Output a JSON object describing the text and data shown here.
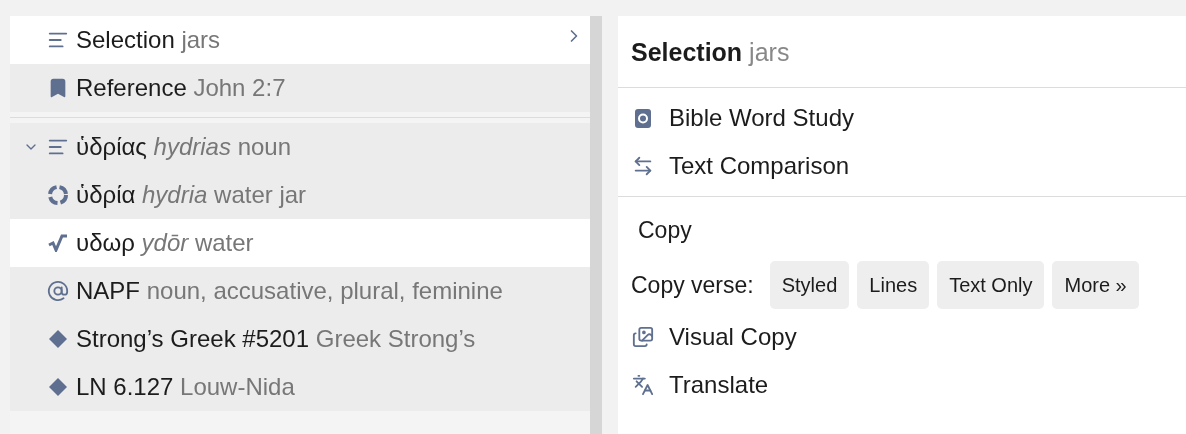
{
  "lookup_panel": {
    "sections": [
      {
        "rows": [
          {
            "kind": "selection",
            "label": "Selection",
            "detail": "jars",
            "highlighted": true
          },
          {
            "kind": "reference",
            "label": "Reference",
            "detail": "John 2:7",
            "highlighted": false
          }
        ]
      },
      {
        "rows": [
          {
            "kind": "lemma",
            "label": "ὑδρίας",
            "transliteration": "hydrias",
            "detail": "noun",
            "expanded": true,
            "highlighted": false
          },
          {
            "kind": "lexeme",
            "label": "ὑδρία",
            "transliteration": "hydria",
            "detail": "water jar",
            "highlighted": false
          },
          {
            "kind": "root",
            "label": "υδωρ",
            "transliteration": "ydōr",
            "detail": "water",
            "highlighted": true
          },
          {
            "kind": "morph",
            "label": "NAPF",
            "detail": "noun, accusative, plural, feminine",
            "highlighted": false
          },
          {
            "kind": "number",
            "label": "Strong’s Greek #5201",
            "detail": "Greek Strong’s",
            "highlighted": false
          },
          {
            "kind": "number",
            "label": "LN 6.127",
            "detail": "Louw-Nida",
            "highlighted": false
          }
        ]
      }
    ]
  },
  "context_menu": {
    "title": "Selection",
    "subtitle": "jars",
    "groups": [
      {
        "items": [
          {
            "kind": "word_study",
            "label": "Bible Word Study"
          },
          {
            "kind": "compare",
            "label": "Text Comparison"
          }
        ]
      },
      {
        "items": [
          {
            "kind": "heading",
            "label": "Copy"
          },
          {
            "kind": "buttons",
            "label": "Copy verse:",
            "buttons": [
              "Styled",
              "Lines",
              "Text Only",
              "More »"
            ]
          },
          {
            "kind": "visual_copy",
            "label": "Visual Copy"
          },
          {
            "kind": "translate",
            "label": "Translate"
          }
        ]
      }
    ]
  }
}
